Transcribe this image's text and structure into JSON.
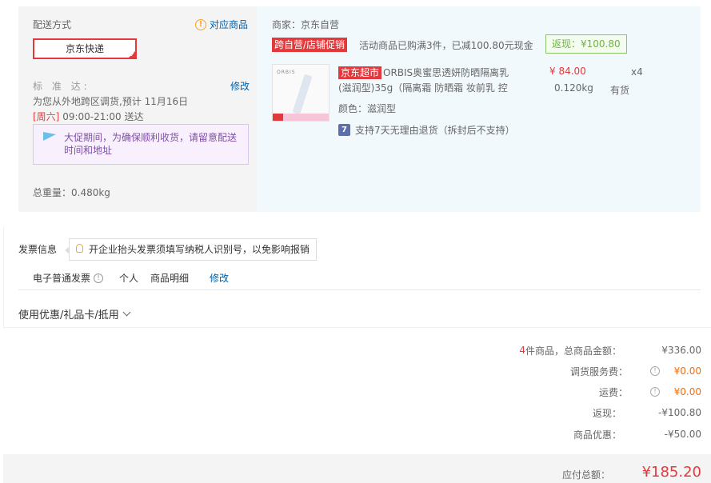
{
  "shipping": {
    "title": "配送方式",
    "corresponding_goods": "对应商品",
    "courier": "京东快递",
    "standard_label": "标 准 达:",
    "modify": "修改",
    "standard_text_pre": "为您从外地跨区调货,预计 11月16日",
    "standard_weekday": "[周六]",
    "standard_text_post": " 09:00-21:00 送达",
    "promo_notice": "大促期间，为确保顺利收货，请留意配送时间和地址",
    "total_weight": "总重量：0.480kg"
  },
  "seller": {
    "label": "商家：京东自营",
    "promo_tag": "跨自营/店铺促销",
    "promo_desc": "活动商品已购满3件，已减100.80元现金",
    "rebate": "返现：¥100.80"
  },
  "item": {
    "image_brand": "ORBIS",
    "tag": "京东超市",
    "name": "ORBIS奥蜜思透妍防晒隔离乳(滋润型)35g（隔离霜 防晒霜 妆前乳 控",
    "color": "颜色：滋润型",
    "return_policy": "支持7天无理由退货（拆封后不支持）",
    "return_icon": "7",
    "price": "¥ 84.00",
    "quantity": "x4",
    "weight": "0.120kg",
    "stock": "有货"
  },
  "invoice": {
    "label": "发票信息",
    "tip": "开企业抬头发票须填写纳税人识别号，以免影响报销",
    "type": "电子普通发票",
    "title_type": "个人",
    "content": "商品明细",
    "modify": "修改"
  },
  "coupon": {
    "label": "使用优惠/礼品卡/抵用"
  },
  "summary": {
    "count": "4",
    "count_suffix": " 件商品，总商品金额：",
    "goods_amount": "¥336.00",
    "transfer_fee_label": "调货服务费：",
    "transfer_fee": "¥0.00",
    "freight_label": "运费：",
    "freight": "¥0.00",
    "rebate_label": "返现：",
    "rebate": "-¥100.80",
    "discount_label": "商品优惠：",
    "discount": "-¥50.00",
    "total_label": "应付总额：",
    "total": "¥185.20"
  },
  "colors": {
    "accent_red": "#e4393c",
    "link_blue": "#005ea7",
    "rebate_green": "#71b247",
    "promo_purple": "#7e4fa4"
  }
}
